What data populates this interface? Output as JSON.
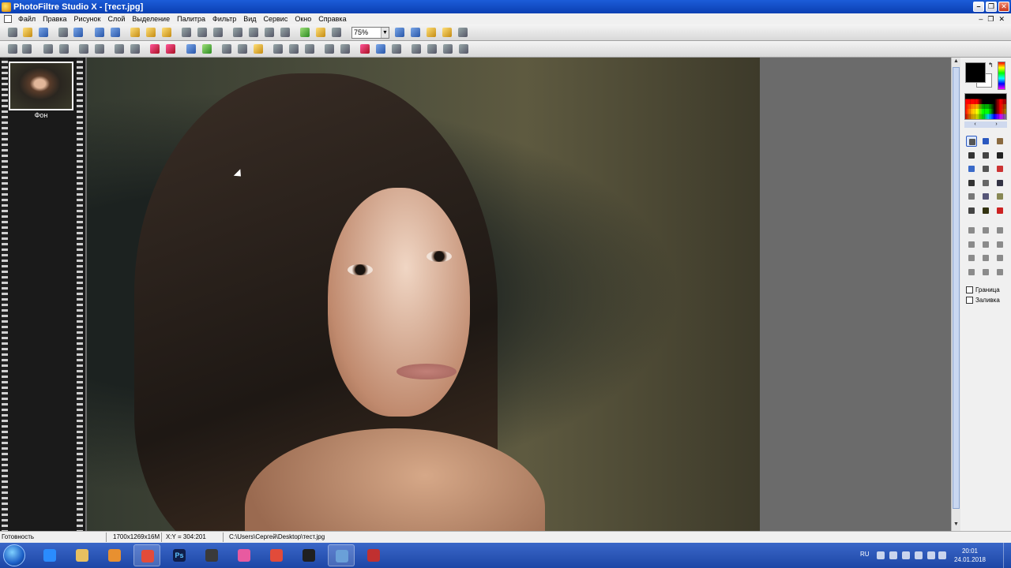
{
  "window": {
    "title": "PhotoFiltre Studio X - [тест.jpg]",
    "min_glyph": "–",
    "max_glyph": "❐",
    "close_glyph": "✕"
  },
  "menu": {
    "items": [
      "Файл",
      "Правка",
      "Рисунок",
      "Слой",
      "Выделение",
      "Палитра",
      "Фильтр",
      "Вид",
      "Сервис",
      "Окно",
      "Справка"
    ],
    "mdi_min": "–",
    "mdi_restore": "❐",
    "mdi_close": "✕"
  },
  "toolbar": {
    "zoom_value": "75%",
    "zoom_arrow": "▼"
  },
  "layers": {
    "items": [
      {
        "label": "Фон"
      }
    ]
  },
  "scrollbar": {
    "up": "▲",
    "down": "▼"
  },
  "palette": {
    "colors": {
      "foreground": "#000000",
      "background": "#ffffff"
    },
    "swap_glyph": "↰",
    "nav_prev": "‹",
    "nav_next": "›"
  },
  "tools": {
    "icons": [
      "selection-arrow-icon",
      "layer-manager-icon",
      "hand-icon",
      "color-picker-icon",
      "magic-wand-icon",
      "line-icon",
      "fill-bucket-icon",
      "spray-icon",
      "eraser-icon",
      "brush-icon",
      "advanced-brush-icon",
      "stamp-icon",
      "blur-icon",
      "smudge-icon",
      "clone-icon",
      "pattern-icon",
      "image-tube-icon",
      "red-eye-icon"
    ],
    "shape_icons": [
      "rectangle-select-icon",
      "ellipse-select-icon",
      "rounded-rect-select-icon",
      "diamond-select-icon",
      "triangle-select-icon",
      "right-triangle-select-icon",
      "lasso-icon",
      "polygon-lasso-icon",
      "open-selection-icon",
      "select-all-icon",
      "invert-selection-icon",
      "custom-shape-icon"
    ],
    "border_label": "Граница",
    "fill_label": "Заливка"
  },
  "status": {
    "ready": "Готовность",
    "dimensions": "1700x1269x16M",
    "coords": "X:Y = 304:201",
    "path": "C:\\Users\\Сергей\\Desktop\\тест.jpg"
  },
  "taskbar": {
    "apps": [
      "internet-explorer-icon",
      "explorer-icon",
      "media-player-icon",
      "chrome-icon",
      "photoshop-icon",
      "app-icon",
      "peacock-app-icon",
      "chrome-icon",
      "film-editor-icon",
      "network-app-icon",
      "photofiltre-icon"
    ],
    "photoshop_label": "Ps",
    "language": "RU",
    "time": "20:01",
    "date": "24.01.2018"
  }
}
